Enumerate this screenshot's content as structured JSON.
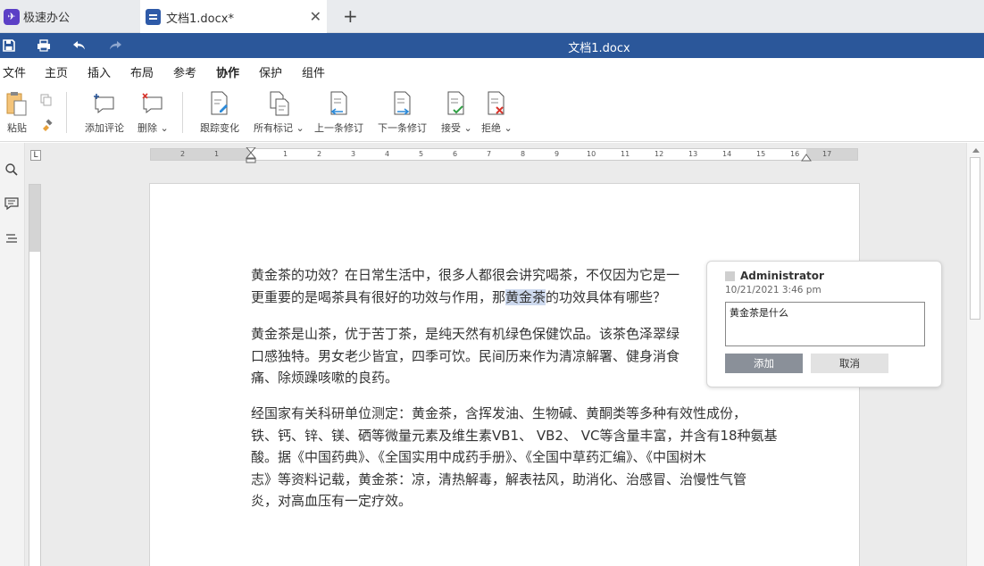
{
  "tabs": [
    {
      "label": "极速办公"
    },
    {
      "label": "文档1.docx*"
    }
  ],
  "icons": {
    "app_glyph": "✈",
    "new_tab": "+",
    "close": "✕"
  },
  "window": {
    "title": "文档1.docx"
  },
  "menu": [
    "文件",
    "主页",
    "插入",
    "布局",
    "参考",
    "协作",
    "保护",
    "组件"
  ],
  "menu_active": "协作",
  "ribbon": {
    "paste": "粘贴",
    "add_comment": "添加评论",
    "delete": "删除 ⌄",
    "track_changes": "跟踪变化",
    "all_markup": "所有标记 ⌄",
    "prev_revision": "上一条修订",
    "next_revision": "下一条修订",
    "accept": "接受 ⌄",
    "reject": "拒绝 ⌄"
  },
  "ruler": {
    "h_ticks": [
      "2",
      "1",
      "1",
      "2",
      "3",
      "4",
      "5",
      "6",
      "7",
      "8",
      "9",
      "10",
      "11",
      "12",
      "13",
      "14",
      "15",
      "16",
      "17"
    ]
  },
  "document": {
    "p1_l1": "黄金茶的功效？在日常生活中，很多人都很会讲究喝茶，不仅因为它是一",
    "p1_l2a": "更重要的是喝茶具有很好的功效与作用，那",
    "p1_l2b": "黄金茶",
    "p1_l2c": "的功效具体有哪些？",
    "p2_l1": "黄金茶是山茶，优于苦丁茶，是纯天然有机绿色保健饮品。该茶色泽翠绿",
    "p2_l2": "口感独特。男女老少皆宜，四季可饮。民间历来作为清凉解署、健身消食",
    "p2_l3": "痛、除烦躁咳嗽的良药。",
    "p3_l1": "经国家有关科研单位测定：黄金茶，含挥发油、生物碱、黄酮类等多种有效性成份，",
    "p3_l2": "铁、钙、锌、镁、硒等微量元素及维生素VB1、 VB2、 VC等含量丰富，并含有18种氨基",
    "p3_l3": "酸。据《中国药典》、《全国实用中成药手册》、《全国中草药汇编》、《中国树木",
    "p3_l4": "志》等资料记载，黄金茶：凉，清热解毒，解表祛风，助消化、治感冒、治慢性气管",
    "p3_l5": "炎，对高血压有一定疗效。"
  },
  "comment": {
    "author": "Administrator",
    "time": "10/21/2021 3:46 pm",
    "text": "黄金茶是什么",
    "add_label": "添加",
    "cancel_label": "取消"
  },
  "colors": {
    "accent": "#2b579a",
    "highlight": "#cdd9ee"
  }
}
